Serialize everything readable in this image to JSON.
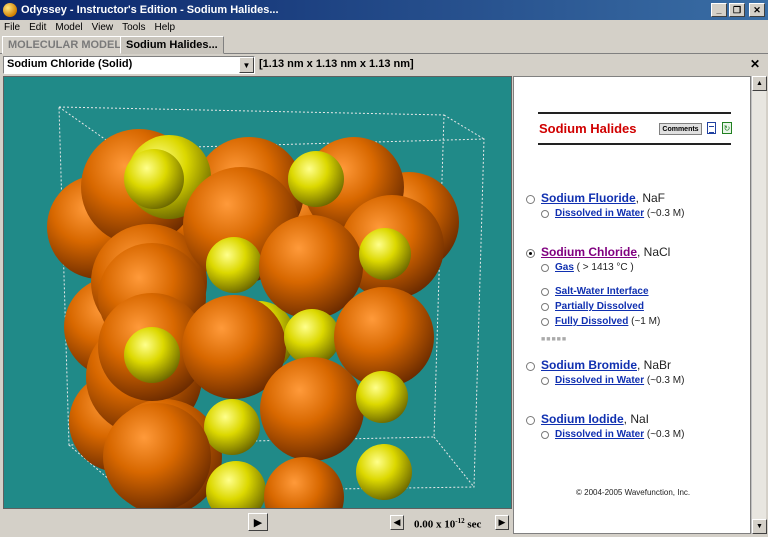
{
  "window": {
    "title": "Odyssey - Instructor's Edition - Sodium Halides...",
    "minimize": "_",
    "maximize": "❐",
    "close": "✕"
  },
  "menu": [
    "File",
    "Edit",
    "Model",
    "View",
    "Tools",
    "Help"
  ],
  "tabs": [
    {
      "label": "MOLECULAR MODELS",
      "active": false
    },
    {
      "label": "Sodium Halides...",
      "active": true
    }
  ],
  "model_selector": {
    "value": "Sodium Chloride (Solid)",
    "dimensions": "[1.13 nm x 1.13 nm x 1.13 nm]"
  },
  "viewer": {
    "background": "#208a88",
    "na_color": "#d4d000",
    "cl_color": "#c85a00"
  },
  "playback": {
    "play": "▶",
    "step_back": "◀",
    "step_forward": "▶",
    "time_value": "0.00 x 10",
    "time_exponent": "-12",
    "time_unit": "sec"
  },
  "panel": {
    "title": "Sodium Halides",
    "title_color": "#d00000",
    "comments_button": "Comments",
    "refresh": "↻",
    "compounds": [
      {
        "name": "Sodium Fluoride",
        "formula": ", NaF",
        "checked": false,
        "options": [
          {
            "label": "Dissolved in Water",
            "note": " (~0.3 M)"
          }
        ]
      },
      {
        "name": "Sodium Chloride",
        "formula": ", NaCl",
        "checked": true,
        "options": [
          {
            "label": "Gas",
            "note": "  ( > 1413 °C )"
          },
          {
            "label": "Salt-Water Interface",
            "note": ""
          },
          {
            "label": "Partially Dissolved",
            "note": ""
          },
          {
            "label": "Fully Dissolved",
            "note": " (~1 M)"
          }
        ]
      },
      {
        "name": "Sodium Bromide",
        "formula": ", NaBr",
        "checked": false,
        "options": [
          {
            "label": "Dissolved in Water",
            "note": " (~0.3 M)"
          }
        ]
      },
      {
        "name": "Sodium Iodide",
        "formula": ", NaI",
        "checked": false,
        "options": [
          {
            "label": "Dissolved in Water",
            "note": " (~0.3 M)"
          }
        ]
      }
    ],
    "more": "■■■■■",
    "copyright": "© 2004-2005  Wavefunction, Inc."
  }
}
